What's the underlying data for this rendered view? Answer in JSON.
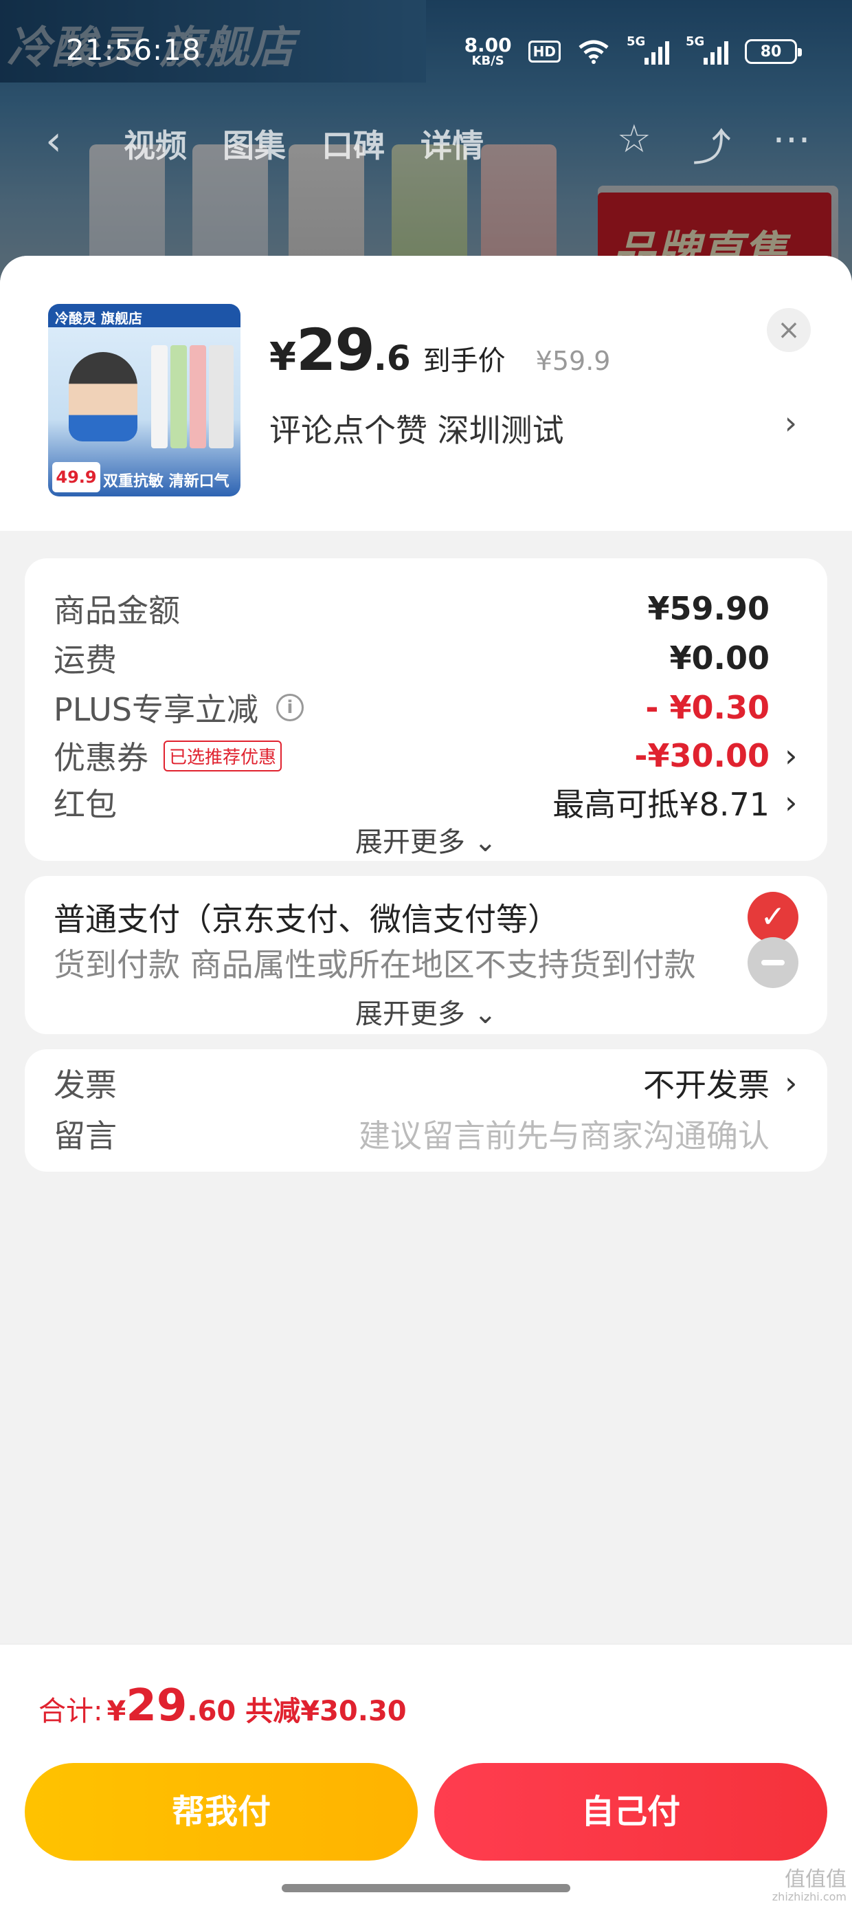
{
  "status_bar": {
    "time": "21:56:18",
    "net_speed_value": "8.00",
    "net_speed_unit": "KB/S",
    "hd_label": "HD",
    "signal1": "5G",
    "signal2": "5G",
    "battery": "80"
  },
  "background_page": {
    "brand_text": "冷酸灵 旗舰店",
    "tabs": [
      "视频",
      "图集",
      "口碑",
      "详情"
    ],
    "badge_text": "品牌直售"
  },
  "product": {
    "thumb_top": "冷酸灵 旗舰店",
    "thumb_price": "49.9",
    "thumb_bottom": "双重抗敏 清新口气",
    "currency": "¥",
    "price_int": "29",
    "price_dec": ".6",
    "price_tag": "到手价",
    "original_price": "¥59.9",
    "promo": "评论点个赞  深圳测试",
    "close_icon": "×"
  },
  "price_card": {
    "rows": [
      {
        "label": "商品金额",
        "value": "¥59.90"
      },
      {
        "label": "运费",
        "value": "¥0.00"
      },
      {
        "label": "PLUS专享立减",
        "value": "- ¥0.30"
      },
      {
        "label": "优惠券",
        "tag": "已选推荐优惠",
        "value": "-¥30.00"
      },
      {
        "label": "红包",
        "value": "最高可抵¥8.71"
      }
    ],
    "expand": "展开更多 ⌄"
  },
  "payment_card": {
    "normal_pay": "普通支付（京东支付、微信支付等）",
    "cod": "货到付款 商品属性或所在地区不支持货到付款",
    "expand": "展开更多 ⌄"
  },
  "extra_card": {
    "invoice_label": "发票",
    "invoice_value": "不开发票",
    "note_label": "留言",
    "note_placeholder": "建议留言前先与商家沟通确认"
  },
  "total": {
    "label": "合计:",
    "currency": "¥",
    "int": "29",
    "dec": ".60",
    "discount": "共减¥30.30"
  },
  "buttons": {
    "help_pay": "帮我付",
    "self_pay": "自己付"
  },
  "watermark": {
    "main": "值值值",
    "sub": "zhizhizhi.com"
  },
  "colors": {
    "accent_red": "#e0222f",
    "help_button": "#ffc200",
    "self_button": "#f5323b"
  }
}
